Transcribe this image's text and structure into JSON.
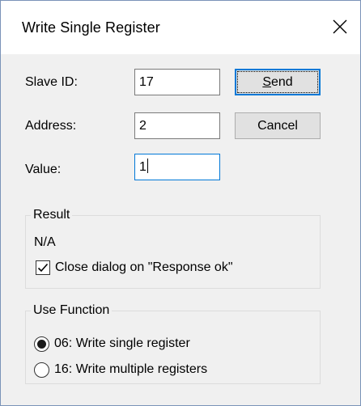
{
  "window": {
    "title": "Write Single Register",
    "close_glyph": "✕"
  },
  "fields": {
    "slave_id": {
      "label": "Slave ID:",
      "value": "17"
    },
    "address": {
      "label": "Address:",
      "value": "2"
    },
    "value": {
      "label": "Value:",
      "value": "1"
    }
  },
  "buttons": {
    "send": {
      "label_underlined": "S",
      "label_rest": "end"
    },
    "cancel": {
      "label": "Cancel"
    }
  },
  "result": {
    "title": "Result",
    "text": "N/A",
    "close_checkbox": {
      "label": "Close dialog on \"Response ok\"",
      "checked": true
    }
  },
  "use_function": {
    "title": "Use Function",
    "options": [
      {
        "label": "06: Write single register",
        "selected": true
      },
      {
        "label": "16: Write multiple registers",
        "selected": false
      }
    ]
  },
  "colors": {
    "focus": "#0078d7",
    "dialog_bg": "#f0f0f0"
  }
}
